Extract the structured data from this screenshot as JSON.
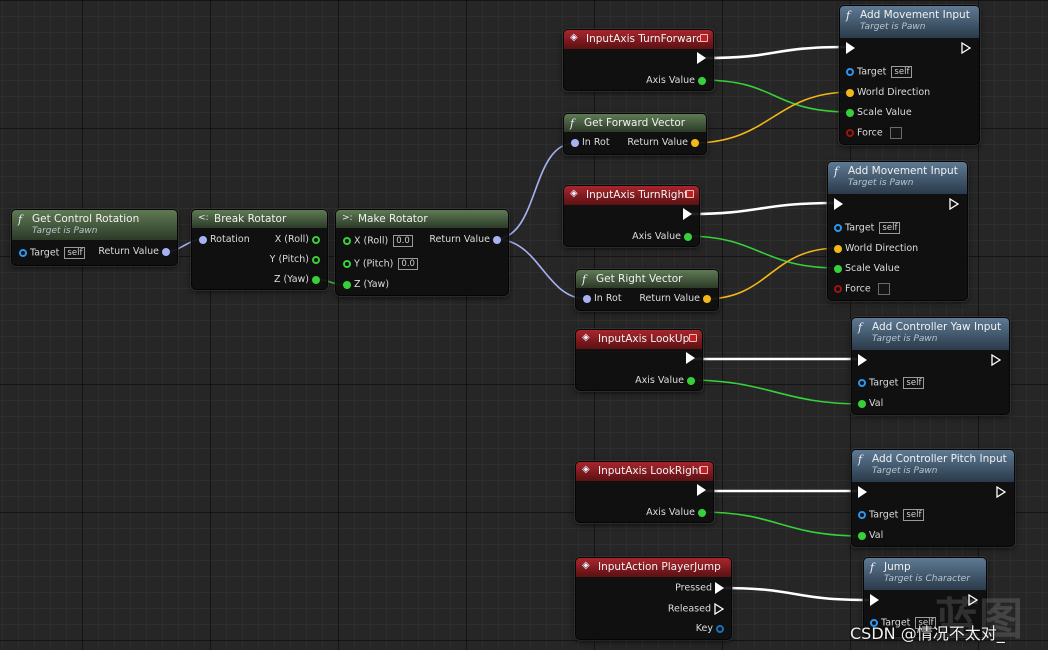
{
  "nodes": {
    "get_control_rotation": {
      "title": "Get Control Rotation",
      "subtitle": "Target is Pawn",
      "target_label": "Target",
      "target_default": "self",
      "return_label": "Return Value"
    },
    "break_rotator": {
      "title": "Break Rotator",
      "rotation_label": "Rotation",
      "x_label": "X (Roll)",
      "y_label": "Y (Pitch)",
      "z_label": "Z (Yaw)"
    },
    "make_rotator": {
      "title": "Make Rotator",
      "x_label": "X (Roll)",
      "x_value": "0.0",
      "y_label": "Y (Pitch)",
      "y_value": "0.0",
      "z_label": "Z (Yaw)",
      "return_label": "Return Value"
    },
    "input_turn_forward": {
      "title": "InputAxis TurnForward",
      "axis_label": "Axis Value"
    },
    "get_forward_vector": {
      "title": "Get Forward Vector",
      "in_label": "In Rot",
      "return_label": "Return Value"
    },
    "add_movement_1": {
      "title": "Add Movement Input",
      "subtitle": "Target is Pawn",
      "target_label": "Target",
      "target_default": "self",
      "world_dir_label": "World Direction",
      "scale_label": "Scale Value",
      "force_label": "Force"
    },
    "input_turn_right": {
      "title": "InputAxis TurnRight",
      "axis_label": "Axis Value"
    },
    "get_right_vector": {
      "title": "Get Right Vector",
      "in_label": "In Rot",
      "return_label": "Return Value"
    },
    "add_movement_2": {
      "title": "Add Movement Input",
      "subtitle": "Target is Pawn",
      "target_label": "Target",
      "target_default": "self",
      "world_dir_label": "World Direction",
      "scale_label": "Scale Value",
      "force_label": "Force"
    },
    "input_look_up": {
      "title": "InputAxis LookUp",
      "axis_label": "Axis Value"
    },
    "add_yaw": {
      "title": "Add Controller Yaw Input",
      "subtitle": "Target is Pawn",
      "target_label": "Target",
      "target_default": "self",
      "val_label": "Val"
    },
    "input_look_right": {
      "title": "InputAxis LookRight",
      "axis_label": "Axis Value"
    },
    "add_pitch": {
      "title": "Add Controller Pitch Input",
      "subtitle": "Target is Pawn",
      "target_label": "Target",
      "target_default": "self",
      "val_label": "Val"
    },
    "input_jump": {
      "title": "InputAction PlayerJump",
      "pressed_label": "Pressed",
      "released_label": "Released",
      "key_label": "Key"
    },
    "jump": {
      "title": "Jump",
      "subtitle": "Target is Character",
      "target_label": "Target",
      "target_default": "self"
    }
  },
  "watermark": "CSDN @情况不太对_",
  "logo_text": "蓝图",
  "colors": {
    "exec_wire": "#ffffff",
    "float_wire": "#38d03a",
    "vector_wire": "#f3b718",
    "rotator_wire": "#a7b2f2",
    "function_header": "#5f7a55",
    "target_function_header": "#5e7a93",
    "event_header": "#a8262c"
  }
}
